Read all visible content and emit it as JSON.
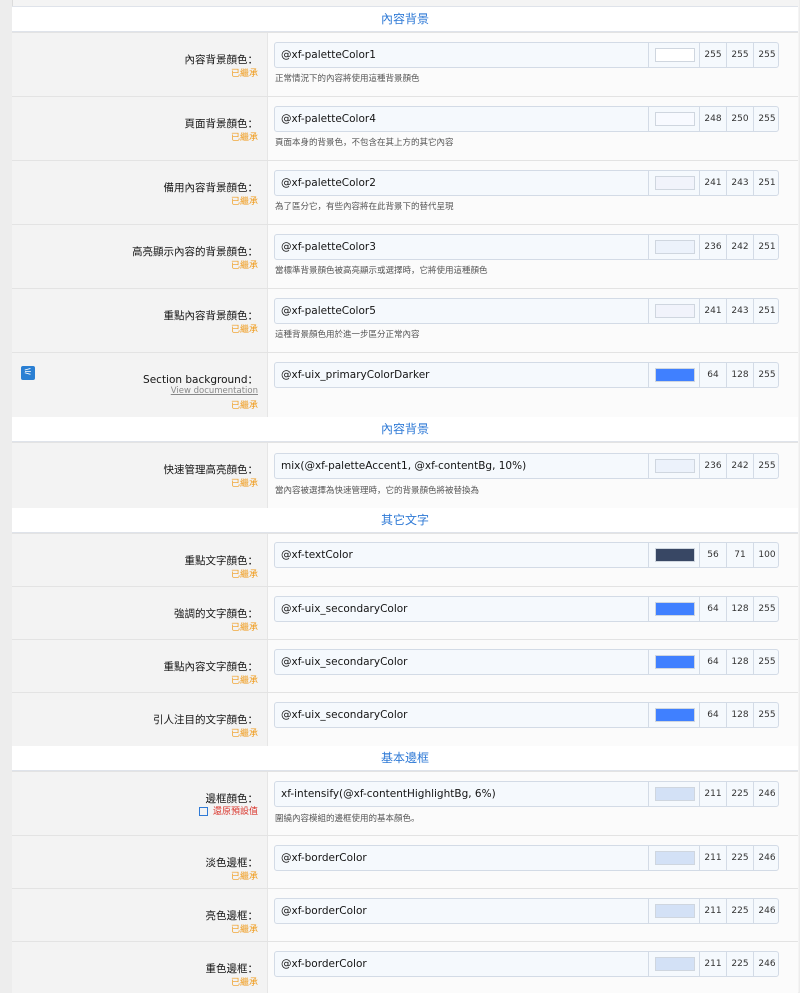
{
  "sections": [
    {
      "title": "內容背景"
    },
    {
      "title": "內容背景"
    },
    {
      "title": "其它文字"
    },
    {
      "title": "基本邊框"
    }
  ],
  "rows": [
    {
      "label": "內容背景顏色：",
      "status": "已繼承",
      "value": "@xf-paletteColor1",
      "swatch": "#ffffff",
      "r": "255",
      "g": "255",
      "b": "255",
      "hint": "正常情況下的內容將使用這種背景顏色"
    },
    {
      "label": "頁面背景顏色：",
      "status": "已繼承",
      "value": "@xf-paletteColor4",
      "swatch": "#f8faff",
      "r": "248",
      "g": "250",
      "b": "255",
      "hint": "頁面本身的背景色，不包含在其上方的其它內容"
    },
    {
      "label": "備用內容背景顏色：",
      "status": "已繼承",
      "value": "@xf-paletteColor2",
      "swatch": "#f1f3fb",
      "r": "241",
      "g": "243",
      "b": "251",
      "hint": "為了區分它，有些內容將在此背景下的替代呈現"
    },
    {
      "label": "高亮顯示內容的背景顏色：",
      "status": "已繼承",
      "value": "@xf-paletteColor3",
      "swatch": "#ecf2fb",
      "r": "236",
      "g": "242",
      "b": "251",
      "hint": "當標準背景顏色被高亮顯示或選擇時，它將使用這種顏色"
    },
    {
      "label": "重點內容背景顏色：",
      "status": "已繼承",
      "value": "@xf-paletteColor5",
      "swatch": "#f1f3fb",
      "r": "241",
      "g": "243",
      "b": "251",
      "hint": "這種背景顏色用於進一步區分正常內容"
    },
    {
      "label": "Section background：",
      "doc": "View documentation",
      "status": "已繼承",
      "value": "@xf-uix_primaryColorDarker",
      "swatch": "#4080ff",
      "r": "64",
      "g": "128",
      "b": "255",
      "hint": ""
    },
    {
      "label": "快速管理高亮顏色：",
      "status": "已繼承",
      "value": "mix(@xf-paletteAccent1, @xf-contentBg, 10%)",
      "swatch": "#ecf2fb",
      "r": "236",
      "g": "242",
      "b": "255",
      "hint": "當內容被選擇為快速管理時，它的背景顏色將被替換為"
    },
    {
      "label": "重點文字顏色：",
      "status": "已繼承",
      "value": "@xf-textColor",
      "swatch": "#384764",
      "r": "56",
      "g": "71",
      "b": "100",
      "hint": ""
    },
    {
      "label": "強調的文字顏色：",
      "status": "已繼承",
      "value": "@xf-uix_secondaryColor",
      "swatch": "#4080ff",
      "r": "64",
      "g": "128",
      "b": "255",
      "hint": ""
    },
    {
      "label": "重點內容文字顏色：",
      "status": "已繼承",
      "value": "@xf-uix_secondaryColor",
      "swatch": "#4080ff",
      "r": "64",
      "g": "128",
      "b": "255",
      "hint": ""
    },
    {
      "label": "引人注目的文字顏色：",
      "status": "已繼承",
      "value": "@xf-uix_secondaryColor",
      "swatch": "#4080ff",
      "r": "64",
      "g": "128",
      "b": "255",
      "hint": ""
    },
    {
      "label": "邊框顏色：",
      "reset": "還原預設值",
      "value": "xf-intensify(@xf-contentHighlightBg, 6%)",
      "swatch": "#d3e1f6",
      "r": "211",
      "g": "225",
      "b": "246",
      "hint": "圍繞內容模組的邊框使用的基本顏色。"
    },
    {
      "label": "淡色邊框：",
      "status": "已繼承",
      "value": "@xf-borderColor",
      "swatch": "#d3e1f6",
      "r": "211",
      "g": "225",
      "b": "246",
      "hint": ""
    },
    {
      "label": "亮色邊框：",
      "status": "已繼承",
      "value": "@xf-borderColor",
      "swatch": "#d3e1f6",
      "r": "211",
      "g": "225",
      "b": "246",
      "hint": ""
    },
    {
      "label": "重色邊框：",
      "status": "已繼承",
      "value": "@xf-borderColor",
      "swatch": "#d3e1f6",
      "r": "211",
      "g": "225",
      "b": "246",
      "hint": ""
    }
  ]
}
